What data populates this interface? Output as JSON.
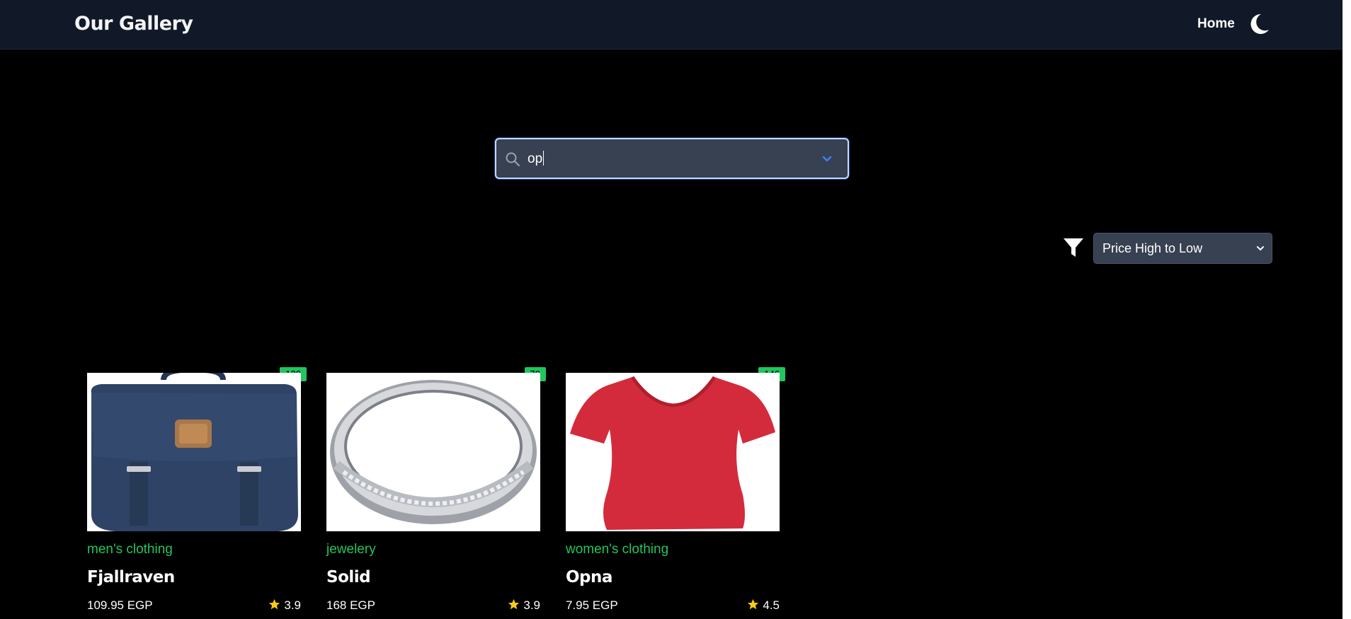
{
  "navbar": {
    "brand": "Our Gallery",
    "home_label": "Home",
    "theme_icon": "moon-icon"
  },
  "search": {
    "value": "op",
    "icon": "search-icon"
  },
  "sort": {
    "selected": "Price High to Low",
    "filter_icon": "filter-icon"
  },
  "colors": {
    "nav_bg": "#111827",
    "page_bg": "#000000",
    "accent_green": "#22c55e",
    "input_bg": "#374151",
    "star": "#facc15"
  },
  "products": [
    {
      "badge": "120",
      "category": "men's clothing",
      "title": "Fjallraven",
      "price": "109.95 EGP",
      "rating": "3.9"
    },
    {
      "badge": "70",
      "category": "jewelery",
      "title": "Solid",
      "price": "168 EGP",
      "rating": "3.9"
    },
    {
      "badge": "146",
      "category": "women's clothing",
      "title": "Opna",
      "price": "7.95 EGP",
      "rating": "4.5"
    }
  ]
}
